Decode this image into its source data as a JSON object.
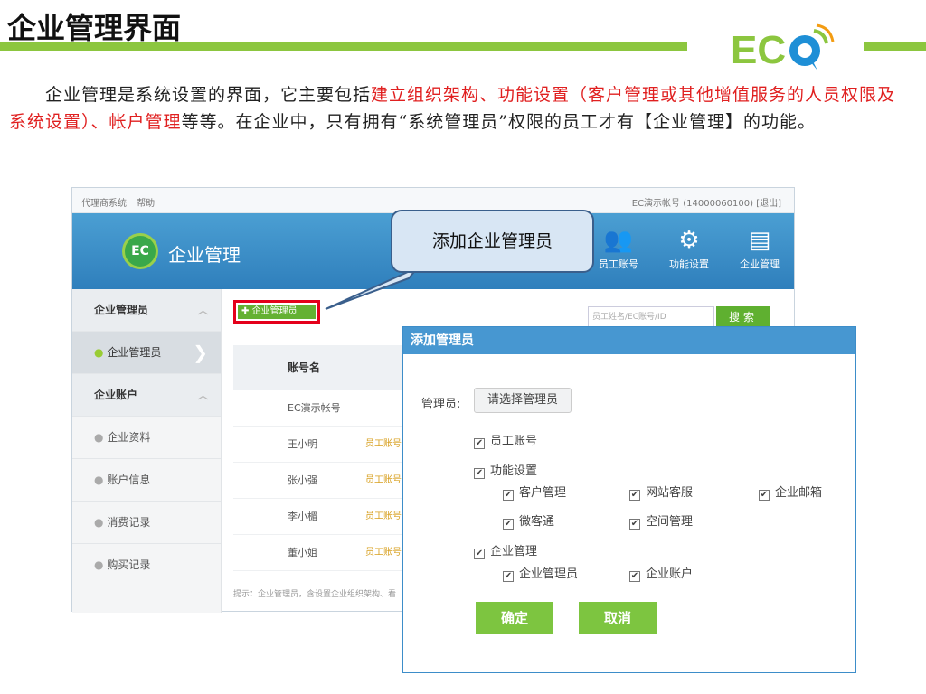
{
  "slide": {
    "title": "企业管理界面",
    "logo_text": "ECO",
    "intro_part1": "企业管理是系统设置的界面，它主要包括",
    "intro_red": "建立组织架构、功能设置（客户管理或其他增值服务的人员权限及系统设置）、帐户管理",
    "intro_part2": "等等。在企业中，只有拥有“系统管理员”权限的员工才有【企业管理】的功能。"
  },
  "app": {
    "top_links": [
      "代理商系统",
      "帮助"
    ],
    "account_info": "EC演示帐号 (14000060100) [退出]",
    "brand_logo": "EC",
    "brand_title": "企业管理",
    "nav": [
      {
        "label": "员工账号",
        "icon": "users-icon"
      },
      {
        "label": "功能设置",
        "icon": "gear-icon"
      },
      {
        "label": "企业管理",
        "icon": "org-icon"
      }
    ],
    "sidebar": [
      {
        "label": "企业管理员",
        "type": "group"
      },
      {
        "label": "企业管理员",
        "type": "active"
      },
      {
        "label": "企业账户",
        "type": "group"
      },
      {
        "label": "企业资料",
        "type": "item"
      },
      {
        "label": "账户信息",
        "type": "item"
      },
      {
        "label": "消费记录",
        "type": "item"
      },
      {
        "label": "购买记录",
        "type": "item"
      }
    ],
    "add_button": "企业管理员",
    "search_placeholder": "员工姓名/EC账号/ID",
    "search_button": "搜索",
    "table_header": "账号名",
    "rows": [
      {
        "name": "EC演示帐号",
        "tag": ""
      },
      {
        "name": "王小明",
        "tag": "员工账号"
      },
      {
        "name": "张小强",
        "tag": "员工账号"
      },
      {
        "name": "李小楣",
        "tag": "员工账号"
      },
      {
        "name": "董小姐",
        "tag": "员工账号"
      }
    ],
    "hint": "提示：企业管理员，含设置企业组织架构、看"
  },
  "callout": "添加企业管理员",
  "dialog": {
    "title": "添加管理员",
    "admin_label": "管理员:",
    "select_placeholder": "请选择管理员",
    "checks": {
      "employee_account": "员工账号",
      "function_settings": "功能设置",
      "customer_mgmt": "客户管理",
      "web_service": "网站客服",
      "enterprise_mail": "企业邮箱",
      "weikeitong": "微客通",
      "space_mgmt": "空间管理",
      "enterprise_mgmt": "企业管理",
      "enterprise_admin": "企业管理员",
      "enterprise_account": "企业账户"
    },
    "confirm": "确定",
    "cancel": "取消"
  }
}
